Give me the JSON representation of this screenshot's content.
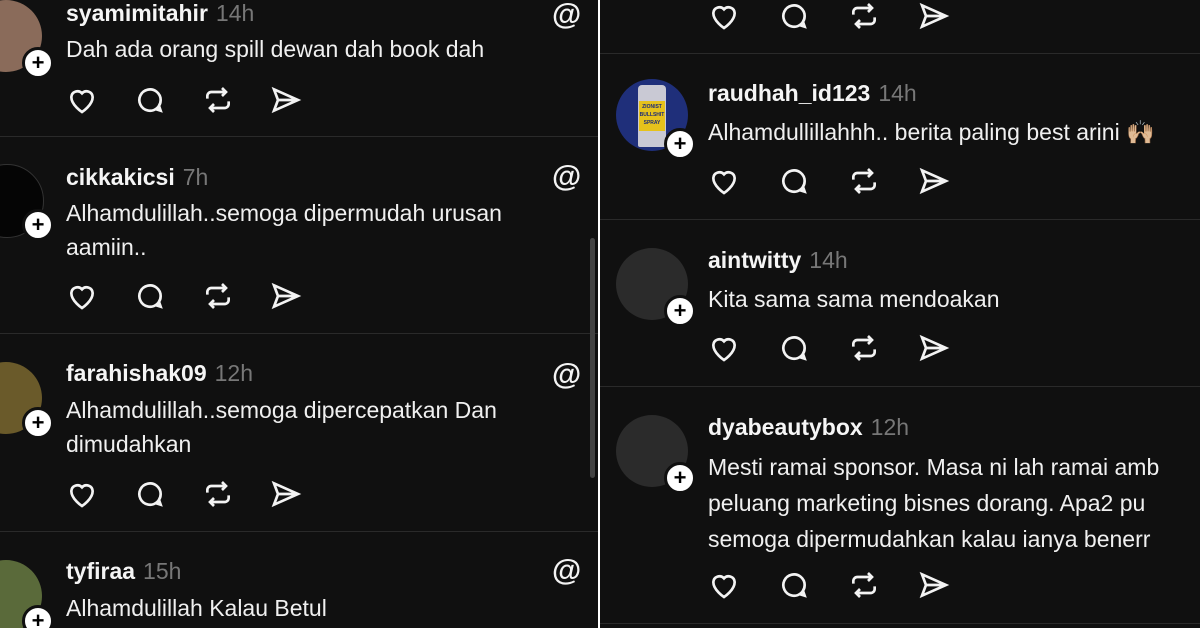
{
  "left": {
    "posts": [
      {
        "username": "syamimitahir",
        "time": "14h",
        "text": [
          "Dah ada orang spill dewan dah book dah"
        ]
      },
      {
        "username": "cikkakicsi",
        "time": "7h",
        "text": [
          "Alhamdulillah..semoga dipermudah urusan",
          "aamiin.."
        ]
      },
      {
        "username": "farahishak09",
        "time": "12h",
        "text": [
          "Alhamdulillah..semoga dipercepatkan Dan",
          "dimudahkan"
        ]
      },
      {
        "username": "tyfiraa",
        "time": "15h",
        "text": [
          "Alhamdulillah Kalau Betul"
        ]
      }
    ]
  },
  "right": {
    "posts": [
      {
        "username": "raudhah_id123",
        "time": "14h",
        "text": [
          "Alhamdullillahhh.. berita paling best arini 🙌🏼"
        ],
        "avatar_text": [
          "ZIONIST",
          "BULLSHIT",
          "SPRAY"
        ]
      },
      {
        "username": "aintwitty",
        "time": "14h",
        "text": [
          "Kita sama sama mendoakan"
        ]
      },
      {
        "username": "dyabeautybox",
        "time": "12h",
        "text": [
          "Mesti ramai sponsor. Masa ni lah ramai amb",
          "peluang marketing bisnes dorang. Apa2 pu",
          "semoga dipermudahkan kalau ianya benerr"
        ]
      }
    ]
  },
  "icons": {
    "follow": "plus-icon",
    "like": "heart-icon",
    "reply": "comment-icon",
    "repost": "repost-icon",
    "share": "send-icon",
    "app": "threads-logo-icon"
  },
  "glyphs": {
    "follow": "+",
    "threads": "@"
  }
}
